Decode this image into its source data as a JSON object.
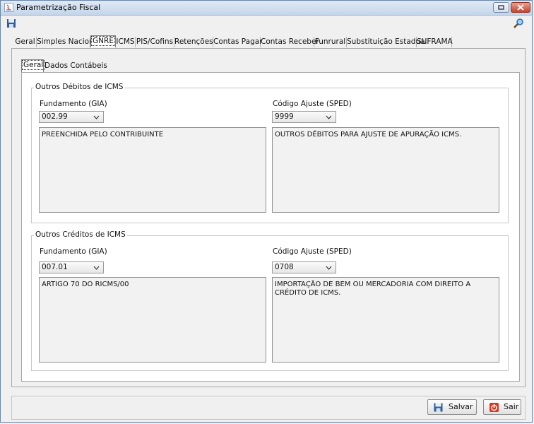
{
  "window": {
    "title": "Parametrização Fiscal"
  },
  "tabs": [
    "Geral",
    "Simples Nacional",
    "GNRE",
    "ICMS",
    "PIS/Cofins",
    "Retenções",
    "Contas Pagar",
    "Contas Receber",
    "Funrural",
    "Substituição Estadual",
    "SUFRAMA"
  ],
  "active_tab": "GNRE",
  "subtabs": [
    "Geral",
    "Dados Contábeis"
  ],
  "active_subtab": "Geral",
  "debitos": {
    "title": "Outros Débitos de ICMS",
    "fundamento_label": "Fundamento (GIA)",
    "fundamento_value": "002.99",
    "fundamento_desc": "PREENCHIDA PELO CONTRIBUINTE",
    "codigo_label": "Código Ajuste (SPED)",
    "codigo_value": "9999",
    "codigo_desc": "OUTROS DÉBITOS PARA AJUSTE DE APURAÇÃO ICMS."
  },
  "creditos": {
    "title": "Outros Créditos de ICMS",
    "fundamento_label": "Fundamento (GIA)",
    "fundamento_value": "007.01",
    "fundamento_desc": "ARTIGO 70 DO RICMS/00",
    "codigo_label": "Código Ajuste (SPED)",
    "codigo_value": "0708",
    "codigo_desc": "IMPORTAÇÃO DE BEM OU MERCADORIA COM DIREITO A CRÉDITO DE ICMS."
  },
  "buttons": {
    "save": "Salvar",
    "exit": "Sair"
  },
  "colors": {
    "accent": "#1b5fa8",
    "close": "#c8432c"
  }
}
